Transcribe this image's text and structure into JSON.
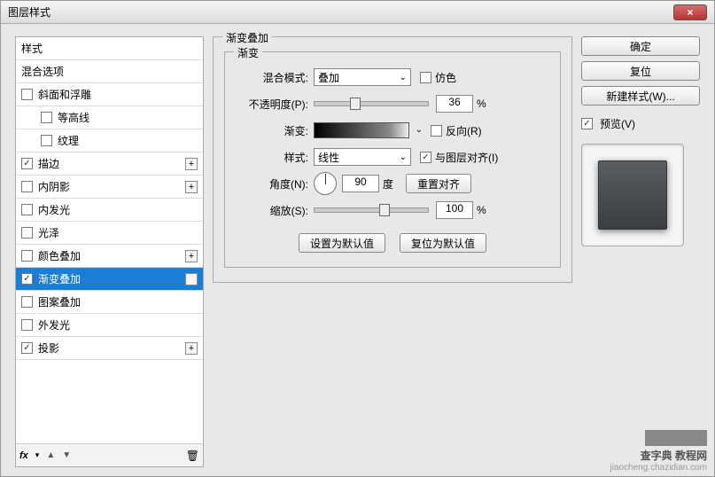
{
  "title": "图层样式",
  "close_icon": "×",
  "sidebar": {
    "header_styles": "样式",
    "header_blend": "混合选项",
    "items": [
      {
        "label": "斜面和浮雕",
        "checked": false,
        "indent": false,
        "plus": false
      },
      {
        "label": "等高线",
        "checked": false,
        "indent": true,
        "plus": false
      },
      {
        "label": "纹理",
        "checked": false,
        "indent": true,
        "plus": false
      },
      {
        "label": "描边",
        "checked": true,
        "indent": false,
        "plus": true
      },
      {
        "label": "内阴影",
        "checked": false,
        "indent": false,
        "plus": true
      },
      {
        "label": "内发光",
        "checked": false,
        "indent": false,
        "plus": false
      },
      {
        "label": "光泽",
        "checked": false,
        "indent": false,
        "plus": false
      },
      {
        "label": "颜色叠加",
        "checked": false,
        "indent": false,
        "plus": true
      },
      {
        "label": "渐变叠加",
        "checked": true,
        "indent": false,
        "plus": true,
        "selected": true
      },
      {
        "label": "图案叠加",
        "checked": false,
        "indent": false,
        "plus": false
      },
      {
        "label": "外发光",
        "checked": false,
        "indent": false,
        "plus": false
      },
      {
        "label": "投影",
        "checked": true,
        "indent": false,
        "plus": true
      }
    ],
    "footer_fx": "fx",
    "footer_trash": "🗑"
  },
  "panel": {
    "title": "渐变叠加",
    "group_title": "渐变",
    "blend_mode_label": "混合模式:",
    "blend_mode_value": "叠加",
    "dither_label": "仿色",
    "opacity_label": "不透明度(P):",
    "opacity_value": "36",
    "opacity_unit": "%",
    "gradient_label": "渐变:",
    "reverse_label": "反向(R)",
    "style_label": "样式:",
    "style_value": "线性",
    "align_label": "与图层对齐(I)",
    "align_checked": true,
    "angle_label": "角度(N):",
    "angle_value": "90",
    "angle_unit": "度",
    "reset_align_btn": "重置对齐",
    "scale_label": "缩放(S):",
    "scale_value": "100",
    "scale_unit": "%",
    "make_default_btn": "设置为默认值",
    "reset_default_btn": "复位为默认值"
  },
  "right": {
    "ok": "确定",
    "cancel": "复位",
    "new_style": "新建样式(W)...",
    "preview_label": "预览(V)",
    "preview_checked": true
  },
  "watermark": {
    "brand": "查字典 教程网",
    "url": "jiaocheng.chazidian.com"
  }
}
